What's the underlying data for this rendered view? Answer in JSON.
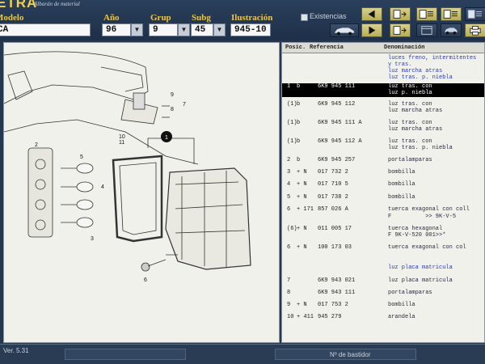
{
  "app": {
    "brand": "ETRA",
    "subtitle": "Albarán de material",
    "version": "Ver. 5.31"
  },
  "fields": {
    "modelo": {
      "label": "Modelo",
      "value": "CA"
    },
    "ano": {
      "label": "Año",
      "value": "96"
    },
    "grup": {
      "label": "Grup",
      "value": "9"
    },
    "subg": {
      "label": "Subg",
      "value": "45"
    },
    "ilustracion": {
      "label": "Ilustración",
      "value": "945-10"
    }
  },
  "existencias": {
    "label": "Existencias",
    "checked": false
  },
  "toolbar": {
    "icons": [
      "arrow-back-icon",
      "arrow-forward-icon",
      "page-arrow-icon",
      "page-arrow-icon",
      "page-list-icon",
      "page-list-icon",
      "page-list-icon",
      "window-icon",
      "car-icon",
      "printer-icon"
    ]
  },
  "table": {
    "headers": {
      "pos": "Posic.",
      "ref": "Referencia",
      "den": "Denominación"
    },
    "rows": [
      {
        "pos": "",
        "mark": "",
        "ref": "",
        "desc": "luces freno, intermitentes",
        "style": "blue"
      },
      {
        "pos": "",
        "mark": "",
        "ref": "",
        "desc": "y tras.",
        "style": "blue"
      },
      {
        "pos": "",
        "mark": "",
        "ref": "",
        "desc": "luz marcha atras",
        "style": "blue"
      },
      {
        "pos": "",
        "mark": "",
        "ref": "",
        "desc": "luz tras. p. niebla",
        "style": "blue"
      },
      {
        "pos": "1",
        "mark": "b",
        "ref": "6K9 945 111",
        "desc": "luz tras. con",
        "style": "sel"
      },
      {
        "pos": "",
        "mark": "",
        "ref": "",
        "desc": "luz p. niebla",
        "style": "sel"
      },
      {
        "pos": "(1)",
        "mark": "b",
        "ref": "6K9 945 112",
        "desc": "luz tras. con",
        "style": ""
      },
      {
        "pos": "",
        "mark": "",
        "ref": "",
        "desc": "luz marcha atras",
        "style": ""
      },
      {
        "pos": "(1)",
        "mark": "b",
        "ref": "6K9 945 111 A",
        "desc": "luz tras. con",
        "style": ""
      },
      {
        "pos": "",
        "mark": "",
        "ref": "",
        "desc": "luz marcha atras",
        "style": ""
      },
      {
        "pos": "(1)",
        "mark": "b",
        "ref": "6K9 945 112 A",
        "desc": "luz tras. con",
        "style": ""
      },
      {
        "pos": "",
        "mark": "",
        "ref": "",
        "desc": "luz tras. p. niebla",
        "style": ""
      },
      {
        "pos": "2",
        "mark": "b",
        "ref": "6K9 945 257",
        "desc": "portalamparas",
        "style": ""
      },
      {
        "pos": "3",
        "mark": "+ N",
        "ref": "017 732 2",
        "desc": "bombilla",
        "style": ""
      },
      {
        "pos": "4",
        "mark": "+ N",
        "ref": "017 710 5",
        "desc": "bombilla",
        "style": ""
      },
      {
        "pos": "5",
        "mark": "+ N",
        "ref": "017 738 2",
        "desc": "bombilla",
        "style": ""
      },
      {
        "pos": "6",
        "mark": "+ 171",
        "ref": "857 026 A",
        "desc": "tuerca exagonal con coll",
        "style": ""
      },
      {
        "pos": "",
        "mark": "",
        "ref": "",
        "desc": "F          >> 9K-V-5",
        "style": ""
      },
      {
        "pos": "(6)",
        "mark": "+ N",
        "ref": "011 005 17",
        "desc": "tuerca hexagonal",
        "style": ""
      },
      {
        "pos": "",
        "mark": "",
        "ref": "",
        "desc": "F 9K-V-520 001>>*",
        "style": ""
      },
      {
        "pos": "6",
        "mark": "+ N",
        "ref": "100 173 03",
        "desc": "tuerca exagonal con col",
        "style": ""
      },
      {
        "pos": "",
        "mark": "",
        "ref": "",
        "desc": "",
        "style": ""
      },
      {
        "pos": "",
        "mark": "",
        "ref": "",
        "desc": "luz placa matricula",
        "style": "blue"
      },
      {
        "pos": "7",
        "mark": "",
        "ref": "6K9 943 021",
        "desc": "luz placa matricula",
        "style": ""
      },
      {
        "pos": "8",
        "mark": "",
        "ref": "6K9 943 111",
        "desc": "portalamparas",
        "style": ""
      },
      {
        "pos": "9",
        "mark": "+ N",
        "ref": "017 753 2",
        "desc": "bombilla",
        "style": ""
      },
      {
        "pos": "10",
        "mark": "+ 411",
        "ref": "945 279",
        "desc": "arandela",
        "style": ""
      }
    ]
  },
  "diagram": {
    "callouts": [
      "1",
      "2",
      "3",
      "4",
      "5",
      "6",
      "7",
      "8",
      "9",
      "10",
      "11"
    ]
  },
  "status": {
    "bastidor_label": "Nº de bastidor"
  },
  "colors": {
    "accent": "#e9c64a",
    "background": "#243650",
    "selection": "#000000",
    "heading_blue": "#2b3ab8"
  }
}
